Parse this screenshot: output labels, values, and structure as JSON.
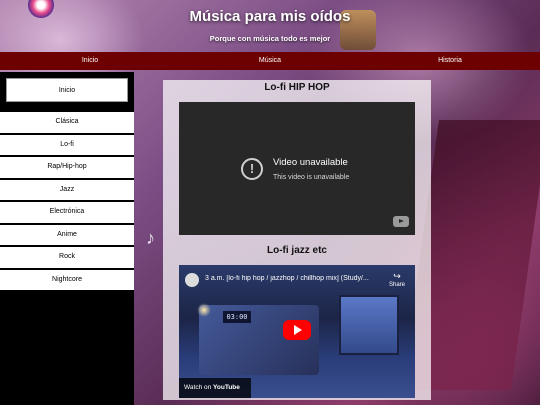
{
  "header": {
    "title": "Música para mis oídos",
    "subtitle": "Porque con música todo es mejor"
  },
  "topnav": {
    "items": [
      "Inicio",
      "Música",
      "Historia"
    ]
  },
  "sidebar": {
    "items": [
      "Inicio",
      "Clásica",
      "Lo-fi",
      "Rap/Hip-hop",
      "Jazz",
      "Electrónica",
      "Anime",
      "Rock",
      "Nightcore"
    ]
  },
  "main": {
    "section1_title": "Lo-fi HIP HOP",
    "video1": {
      "title": "Video unavailable",
      "subtitle": "This video is unavailable"
    },
    "section2_title": "Lo-fi jazz etc",
    "video2": {
      "title": "3 a.m. [lo-fi hip hop / jazzhop / chillhop mix] (Study/...",
      "clock": "03:00",
      "share_label": "Share",
      "watch_on": "Watch on",
      "youtube_label": "YouTube"
    }
  },
  "colors": {
    "nav_bg": "#6d0000",
    "sidebar_bg": "#000000",
    "play_button": "#ff0000"
  }
}
